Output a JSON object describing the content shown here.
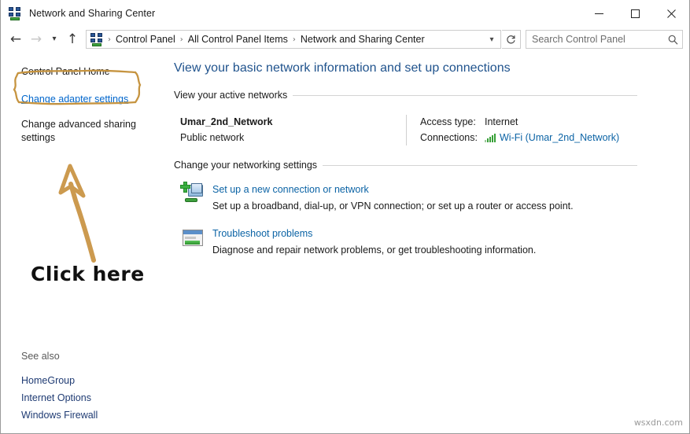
{
  "window": {
    "title": "Network and Sharing Center",
    "icon": "network-icon",
    "controls": {
      "minimize": "minimize-icon",
      "maximize": "maximize-icon",
      "close": "close-icon"
    }
  },
  "nav": {
    "back": "back-arrow-icon",
    "forward": "forward-arrow-icon",
    "recent": "chevron-down-icon",
    "up": "up-arrow-icon",
    "refresh": "refresh-icon",
    "address_dropdown": "chevron-down-icon",
    "breadcrumbs": [
      "Control Panel",
      "All Control Panel Items",
      "Network and Sharing Center"
    ],
    "separator": "›"
  },
  "search": {
    "placeholder": "Search Control Panel",
    "value": "",
    "icon": "search-icon"
  },
  "sidebar": {
    "home_label": "Control Panel Home",
    "links": [
      {
        "label": "Change adapter settings",
        "highlighted": true
      },
      {
        "label": "Change advanced sharing settings",
        "highlighted": false
      }
    ],
    "see_also_title": "See also",
    "see_also": [
      "HomeGroup",
      "Internet Options",
      "Windows Firewall"
    ]
  },
  "annotation": {
    "callout_text": "Click here",
    "highlight_color": "#c69440",
    "arrow_color": "#cc9a4f",
    "text_color": "#111111"
  },
  "main": {
    "page_title": "View your basic network information and set up connections",
    "sections": [
      {
        "heading": "View your active networks"
      },
      {
        "heading": "Change your networking settings"
      }
    ],
    "active_network": {
      "name": "Umar_2nd_Network",
      "type": "Public network",
      "details": [
        {
          "label": "Access type:",
          "value": "Internet",
          "is_link": false,
          "icon": null
        },
        {
          "label": "Connections:",
          "value": "Wi-Fi (Umar_2nd_Network)",
          "is_link": true,
          "icon": "wifi-signal-icon"
        }
      ]
    },
    "tasks": [
      {
        "icon": "setup-connection-icon",
        "title": "Set up a new connection or network",
        "description": "Set up a broadband, dial-up, or VPN connection; or set up a router or access point."
      },
      {
        "icon": "troubleshoot-icon",
        "title": "Troubleshoot problems",
        "description": "Diagnose and repair network problems, or get troubleshooting information."
      }
    ]
  },
  "watermark": "wsxdn.com"
}
